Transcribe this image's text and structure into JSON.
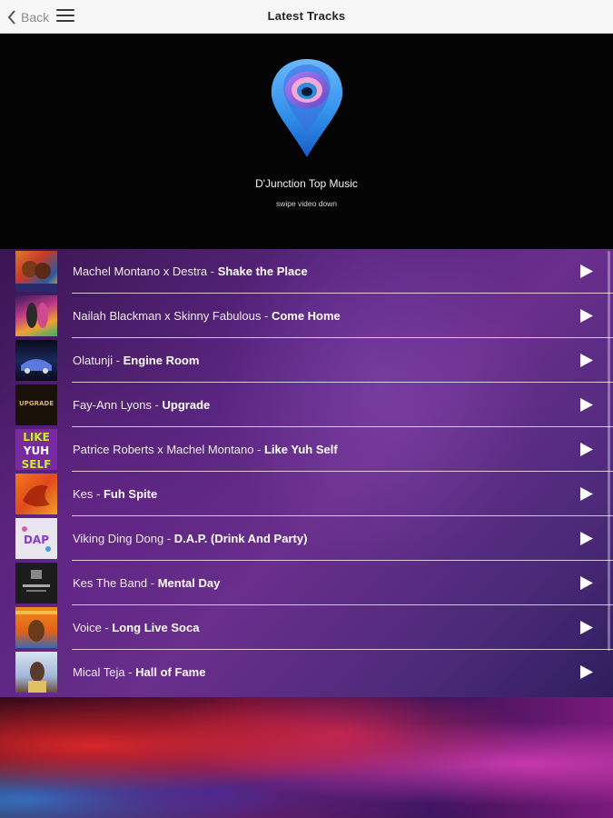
{
  "header": {
    "back_label": "Back",
    "title": "Latest Tracks"
  },
  "hero": {
    "title": "D'Junction Top Music",
    "subtitle": "swipe video down"
  },
  "tracks": [
    {
      "artist": "Machel Montano x Destra - ",
      "song": "Shake the Place"
    },
    {
      "artist": "Nailah Blackman x Skinny Fabulous - ",
      "song": "Come Home"
    },
    {
      "artist": "Olatunji - ",
      "song": "Engine Room"
    },
    {
      "artist": "Fay-Ann Lyons - ",
      "song": "Upgrade"
    },
    {
      "artist": "Patrice Roberts x Machel Montano - ",
      "song": "Like Yuh Self"
    },
    {
      "artist": "Kes - ",
      "song": "Fuh Spite"
    },
    {
      "artist": "Viking Ding Dong - ",
      "song": "D.A.P. (Drink And Party)"
    },
    {
      "artist": "Kes The Band - ",
      "song": "Mental Day"
    },
    {
      "artist": "Voice - ",
      "song": "Long Live Soca"
    },
    {
      "artist": "Mical Teja - ",
      "song": "Hall of Fame"
    }
  ],
  "thumb_text": {
    "t4": "UPGRADE",
    "t5": [
      "LIKE",
      "YUH",
      "SELF"
    ],
    "t7": "DAP"
  },
  "colors": {
    "header_bg": "#f7f7f8",
    "hero_bg": "#040404",
    "list_bg": "#5a2580",
    "play_icon": "#ffffff"
  },
  "icons": {
    "back": "chevron-left-icon",
    "menu": "hamburger-menu-icon",
    "play": "play-icon",
    "logo": "location-pin-logo"
  }
}
